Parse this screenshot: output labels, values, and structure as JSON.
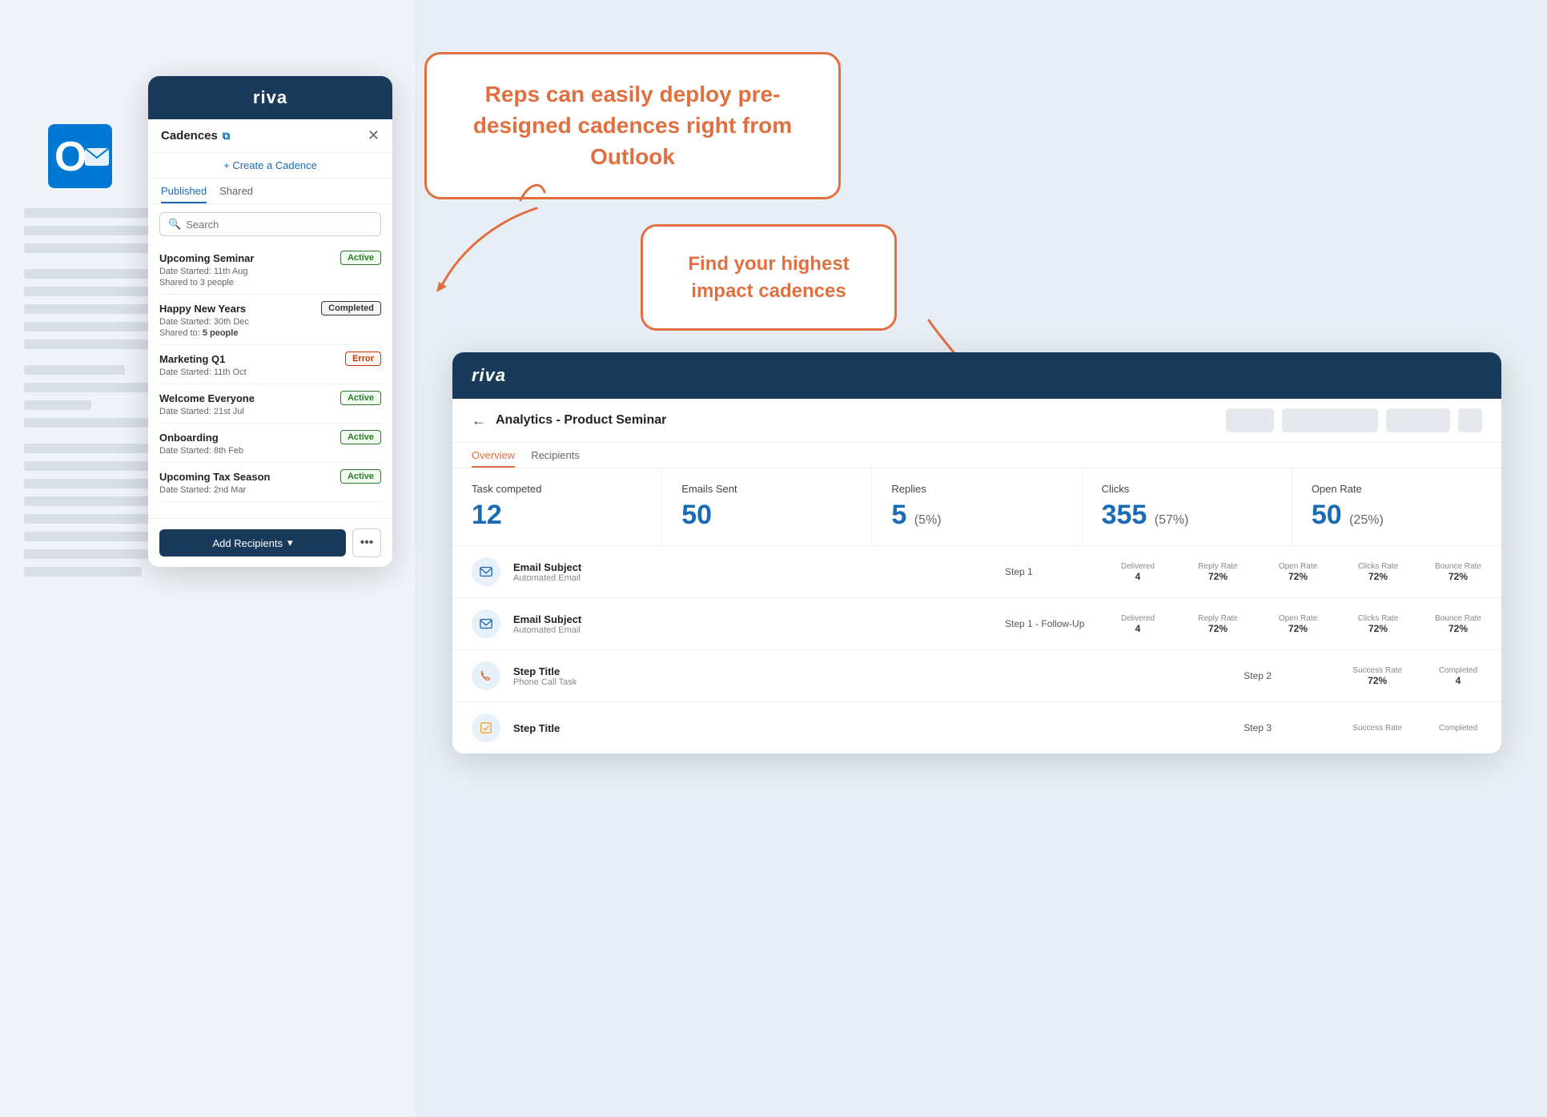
{
  "background": {
    "color": "#e8eef5"
  },
  "callouts": {
    "top": {
      "text": "Reps can easily deploy pre-designed cadences right from Outlook"
    },
    "bottom": {
      "text": "Find your highest impact cadences"
    }
  },
  "riva_panel": {
    "logo": "riva",
    "title": "Cadences",
    "create_label": "+ Create a Cadence",
    "close_icon": "✕",
    "external_icon": "⧉",
    "tabs": [
      {
        "label": "Published",
        "active": true
      },
      {
        "label": "Shared",
        "active": false
      }
    ],
    "search_placeholder": "Search",
    "cadences": [
      {
        "name": "Upcoming Seminar",
        "badge": "Active",
        "badge_type": "active",
        "detail1": "Date Started: 11th Aug",
        "detail2": "Shared to 3 people"
      },
      {
        "name": "Happy New Years",
        "badge": "Completed",
        "badge_type": "completed",
        "detail1": "Date Started: 30th Dec",
        "detail2": "Shared to: 5 people",
        "detail2_bold": "5 people"
      },
      {
        "name": "Marketing Q1",
        "badge": "Error",
        "badge_type": "error",
        "detail1": "Date Started: 11th Oct",
        "detail2": ""
      },
      {
        "name": "Welcome Everyone",
        "badge": "Active",
        "badge_type": "active",
        "detail1": "Date Started: 21st Jul",
        "detail2": ""
      },
      {
        "name": "Onboarding",
        "badge": "Active",
        "badge_type": "active",
        "detail1": "Date Started: 8th Feb",
        "detail2": ""
      },
      {
        "name": "Upcoming Tax Season",
        "badge": "Active",
        "badge_type": "active",
        "detail1": "Date Started: 2nd Mar",
        "detail2": ""
      }
    ],
    "footer": {
      "add_recipients_label": "Add Recipients",
      "dropdown_icon": "▾",
      "more_icon": "•••"
    }
  },
  "analytics_panel": {
    "logo": "riva",
    "title": "Analytics - Product Seminar",
    "back_icon": "←",
    "tabs": [
      {
        "label": "Overview",
        "active": true
      },
      {
        "label": "Recipients",
        "active": false
      }
    ],
    "stats": [
      {
        "label": "Task competed",
        "value": "12",
        "sub": ""
      },
      {
        "label": "Emails Sent",
        "value": "50",
        "sub": ""
      },
      {
        "label": "Replies",
        "value": "5",
        "sub": "(5%)"
      },
      {
        "label": "Clicks",
        "value": "355",
        "sub": "(57%)"
      },
      {
        "label": "Open Rate",
        "value": "50",
        "sub": "(25%)"
      }
    ],
    "table_rows": [
      {
        "icon_type": "email",
        "title": "Email Subject",
        "subtitle": "Automated Email",
        "step": "Step 1",
        "stats": [
          {
            "label": "Delivered",
            "value": "4"
          },
          {
            "label": "Reply Rate",
            "value": "72%"
          },
          {
            "label": "Open Rate",
            "value": "72%"
          },
          {
            "label": "Clicks Rate",
            "value": "72%"
          },
          {
            "label": "Bounce Rate",
            "value": "72%"
          }
        ]
      },
      {
        "icon_type": "email",
        "title": "Email Subject",
        "subtitle": "Automated Email",
        "step": "Step 1 - Follow-Up",
        "stats": [
          {
            "label": "Delivered",
            "value": "4"
          },
          {
            "label": "Reply Rate",
            "value": "72%"
          },
          {
            "label": "Open Rate",
            "value": "72%"
          },
          {
            "label": "Clicks Rate",
            "value": "72%"
          },
          {
            "label": "Bounce Rate",
            "value": "72%"
          }
        ]
      },
      {
        "icon_type": "phone",
        "title": "Step Title",
        "subtitle": "Phone Call Task",
        "step": "Step 2",
        "stats": [
          {
            "label": "Success Rate",
            "value": "72%"
          },
          {
            "label": "Completed",
            "value": "4"
          }
        ]
      },
      {
        "icon_type": "task",
        "title": "Step Title",
        "subtitle": "",
        "step": "Step 3",
        "stats": [
          {
            "label": "Success Rate",
            "value": ""
          },
          {
            "label": "Completed",
            "value": ""
          }
        ]
      }
    ]
  }
}
